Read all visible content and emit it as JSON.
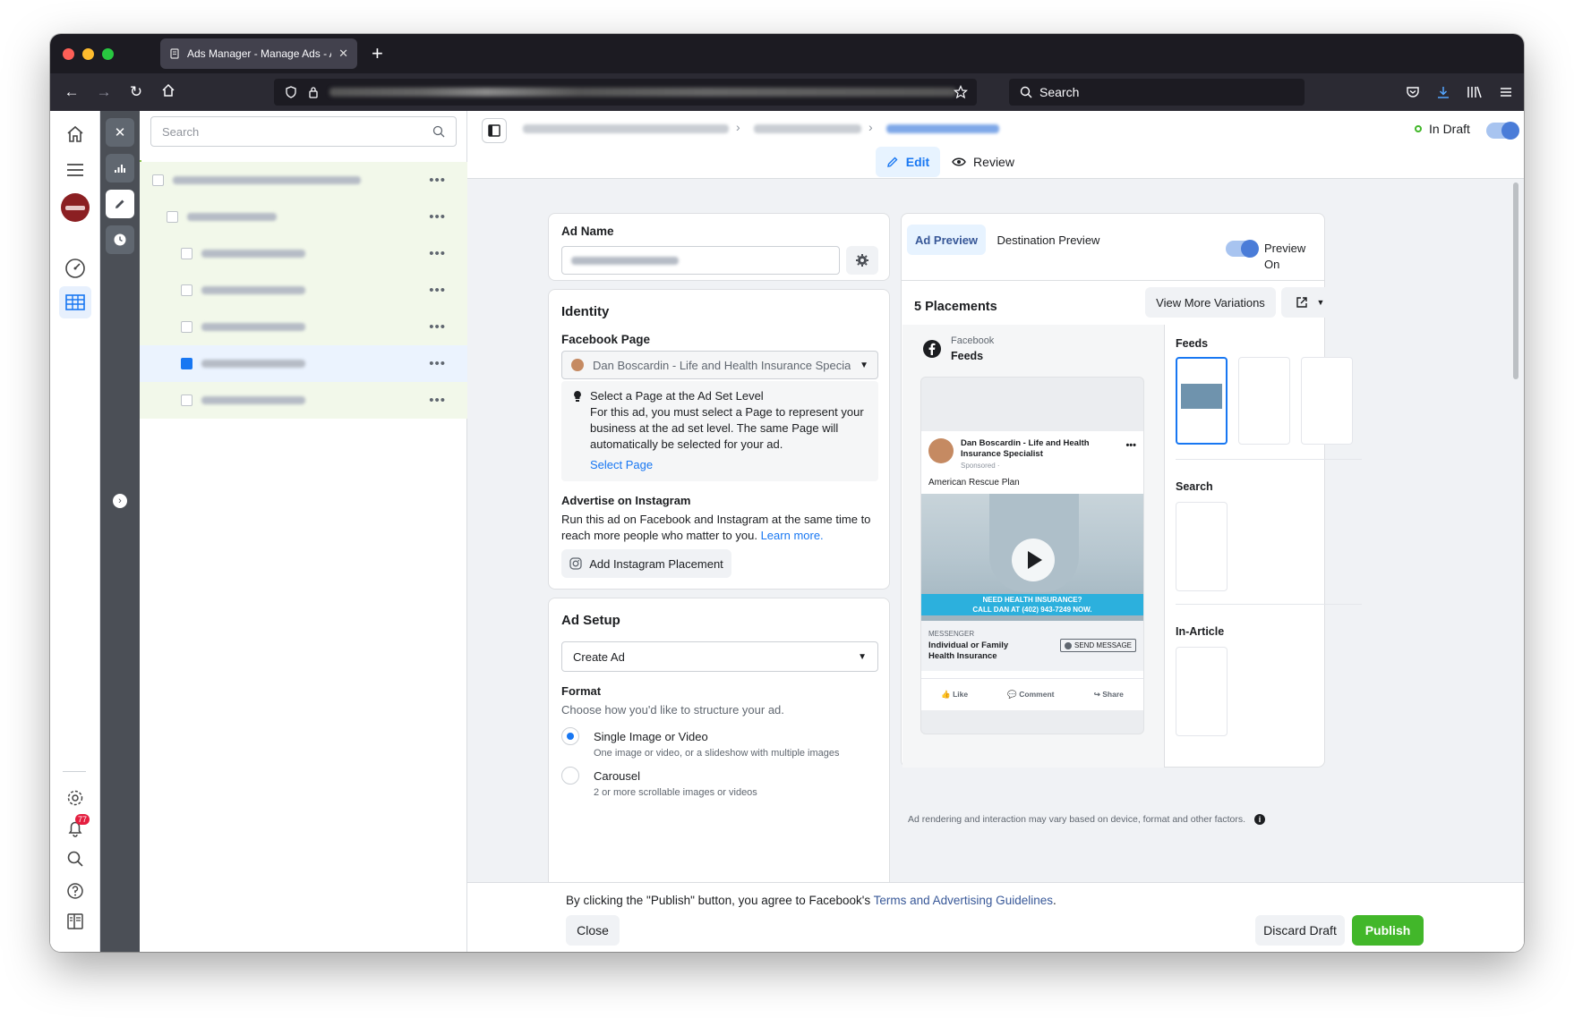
{
  "browser": {
    "tab_title": "Ads Manager - Manage Ads - Ac",
    "search_placeholder": "Search"
  },
  "sidebar": {
    "search_placeholder": "Search",
    "notification_count": "77"
  },
  "header": {
    "status_label": "In Draft",
    "edit_label": "Edit",
    "review_label": "Review",
    "more_label": "..."
  },
  "ad_name": {
    "label": "Ad Name"
  },
  "identity": {
    "title": "Identity",
    "page_label": "Facebook Page",
    "page_value": "Dan Boscardin - Life and Health Insurance Speciali...",
    "notice_title": "Select a Page at the Ad Set Level",
    "notice_body_1": "For this ad, you must select a Page to represent your",
    "notice_body_2": "business at the ad set level. The same Page will",
    "notice_body_3": "automatically be selected for your ad.",
    "notice_link": "Select Page",
    "instagram_title": "Advertise on Instagram",
    "instagram_body_1": "Run this ad on Facebook and Instagram at the same time to",
    "instagram_body_2": "reach more people who matter to you.",
    "instagram_link": "Learn more.",
    "instagram_button": "Add Instagram Placement"
  },
  "ad_setup": {
    "title": "Ad Setup",
    "select_value": "Create Ad",
    "format_label": "Format",
    "format_help": "Choose how you'd like to structure your ad.",
    "options": [
      {
        "label": "Single Image or Video",
        "desc": "One image or video, or a slideshow with multiple images",
        "selected": true
      },
      {
        "label": "Carousel",
        "desc": "2 or more scrollable images or videos",
        "selected": false
      }
    ]
  },
  "preview": {
    "tab_ad": "Ad Preview",
    "tab_destination": "Destination Preview",
    "toggle_label": "Preview On",
    "placements_count": "5 Placements",
    "view_more": "View More Variations",
    "platform": "Facebook",
    "placement": "Feeds",
    "post": {
      "author_1": "Dan Boscardin - Life and Health",
      "author_2": "Insurance Specialist",
      "sponsored": "Sponsored · ",
      "text": "American Rescue Plan",
      "banner_1": "NEED HEALTH INSURANCE?",
      "banner_2": "CALL DAN AT (402) 943-7249 NOW.",
      "cta_source": "MESSENGER",
      "cta_title_1": "Individual or Family",
      "cta_title_2": "Health Insurance",
      "cta_button": "SEND MESSAGE",
      "like": "Like",
      "comment": "Comment",
      "share": "Share"
    },
    "groups": {
      "feeds": "Feeds",
      "search": "Search",
      "in_article": "In-Article"
    },
    "disclaimer": "Ad rendering and interaction may vary based on device, format and other factors."
  },
  "footer": {
    "terms_prefix": "By clicking the \"Publish\" button, you agree to Facebook's",
    "terms_link": "Terms and Advertising Guidelines",
    "terms_suffix": ".",
    "close": "Close",
    "discard": "Discard Draft",
    "publish": "Publish"
  },
  "colors": {
    "accent": "#1877f2",
    "publish_green": "#42b72a",
    "tree_highlight": "#f2f8ea"
  }
}
